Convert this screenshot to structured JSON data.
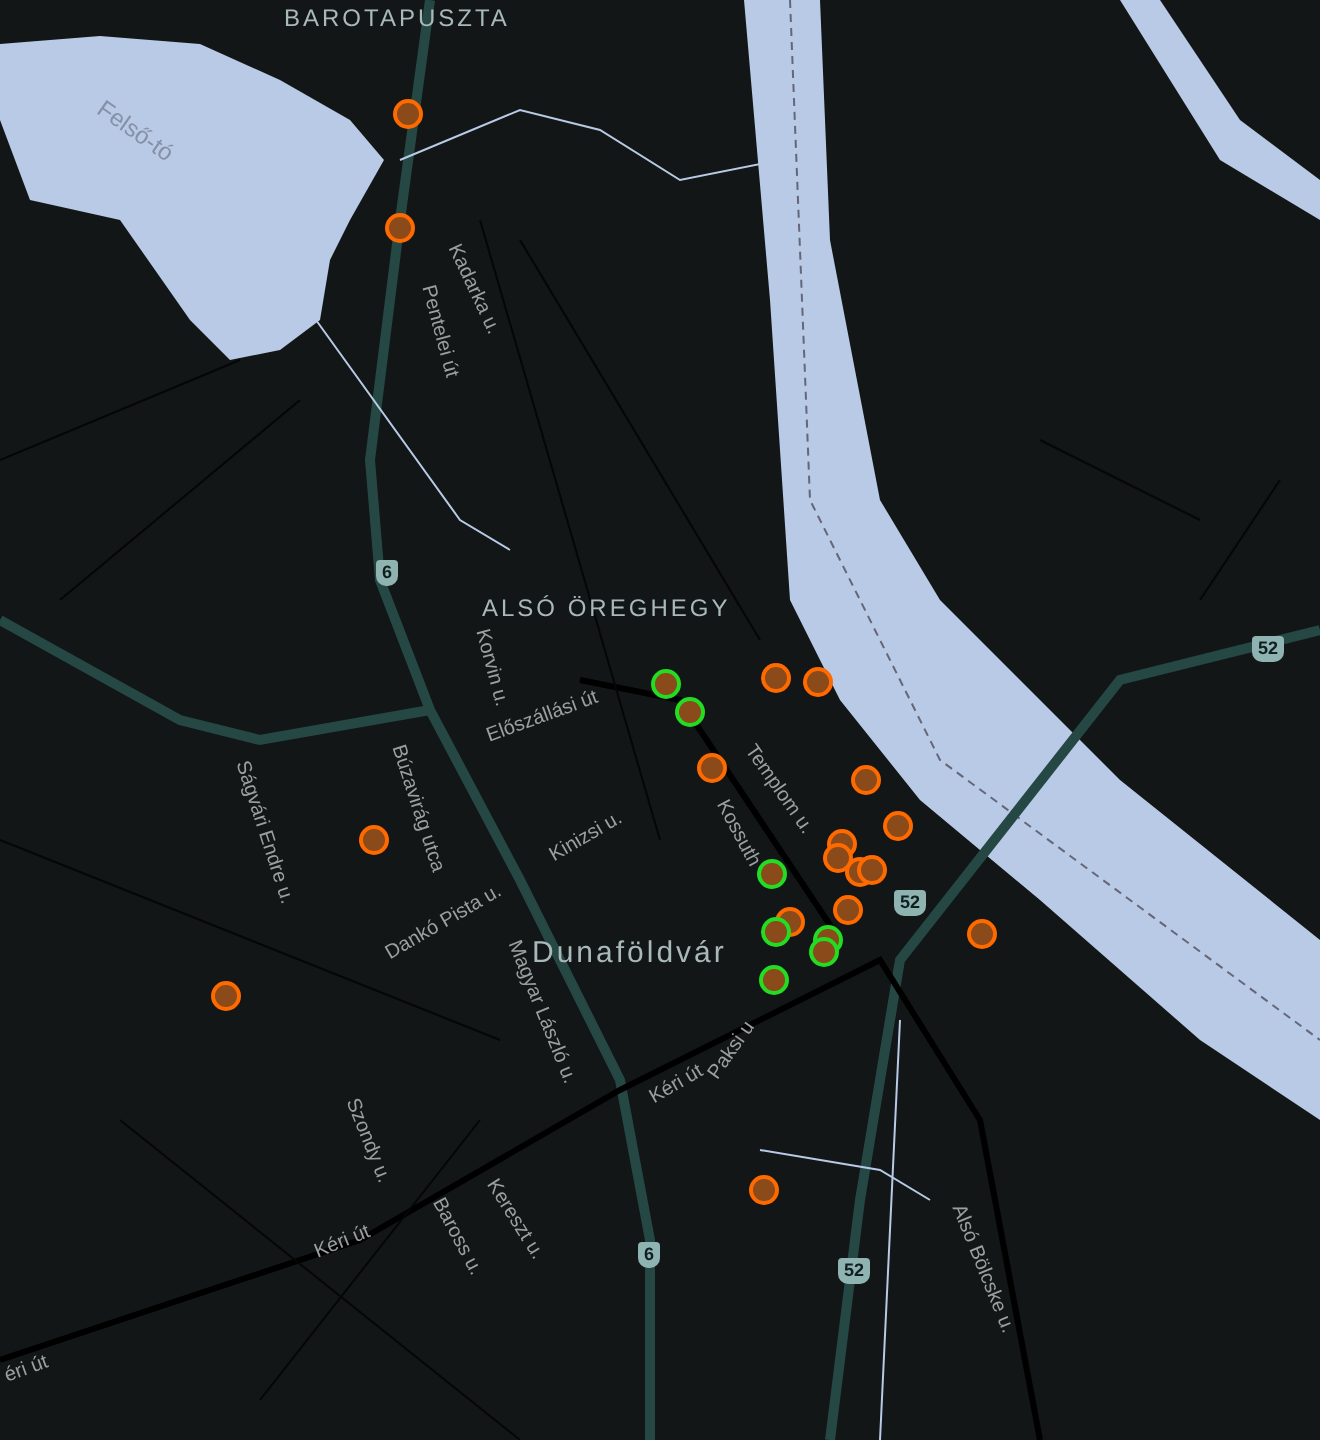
{
  "map": {
    "labels": [
      {
        "text": "BAROTAPUSZTA",
        "kind": "locality"
      },
      {
        "text": "Felső-tó",
        "kind": "water"
      },
      {
        "text": "Kadarka u.",
        "kind": "street"
      },
      {
        "text": "Pentelei út",
        "kind": "street"
      },
      {
        "text": "ALSÓ ÖREGHEGY",
        "kind": "locality"
      },
      {
        "text": "Korvin u.",
        "kind": "street"
      },
      {
        "text": "Előszállási út",
        "kind": "street"
      },
      {
        "text": "Ságvári Endre u.",
        "kind": "street"
      },
      {
        "text": "Búzavirág utca",
        "kind": "street"
      },
      {
        "text": "Templom u.",
        "kind": "street"
      },
      {
        "text": "Kossuth",
        "kind": "street"
      },
      {
        "text": "Kinizsi u.",
        "kind": "street"
      },
      {
        "text": "Dankó Pista u.",
        "kind": "street"
      },
      {
        "text": "Magyar László u.",
        "kind": "street"
      },
      {
        "text": "Dunaföldvár",
        "kind": "town"
      },
      {
        "text": "Szondy u.",
        "kind": "street"
      },
      {
        "text": "Kéri út",
        "kind": "street"
      },
      {
        "text": "Paksi u",
        "kind": "street"
      },
      {
        "text": "Kereszt u.",
        "kind": "street"
      },
      {
        "text": "Baross u.",
        "kind": "street"
      },
      {
        "text": "Kéri út",
        "kind": "street"
      },
      {
        "text": "éri út",
        "kind": "street"
      },
      {
        "text": "Alsó Bölcske u.",
        "kind": "street"
      }
    ],
    "shields": [
      {
        "text": "6"
      },
      {
        "text": "6"
      },
      {
        "text": "52"
      },
      {
        "text": "52"
      },
      {
        "text": "52"
      }
    ],
    "markers": [
      {
        "color": "#ff6a00"
      },
      {
        "color": "#ff6a00"
      },
      {
        "color": "#ff6a00"
      },
      {
        "color": "#ff6a00"
      },
      {
        "color": "#ff6a00"
      },
      {
        "color": "#ff6a00"
      },
      {
        "color": "#ff6a00"
      },
      {
        "color": "#ff6a00"
      },
      {
        "color": "#ff6a00"
      },
      {
        "color": "#ff6a00"
      },
      {
        "color": "#ff6a00"
      },
      {
        "color": "#ff6a00"
      },
      {
        "color": "#ff6a00"
      },
      {
        "color": "#ff6a00"
      },
      {
        "color": "#ff6a00"
      },
      {
        "color": "#ff6a00"
      },
      {
        "color": "#ff6a00"
      },
      {
        "color": "#22dd22"
      },
      {
        "color": "#22dd22"
      },
      {
        "color": "#22dd22"
      },
      {
        "color": "#22dd22"
      },
      {
        "color": "#22dd22"
      },
      {
        "color": "#22dd22"
      },
      {
        "color": "#22dd22"
      }
    ]
  }
}
